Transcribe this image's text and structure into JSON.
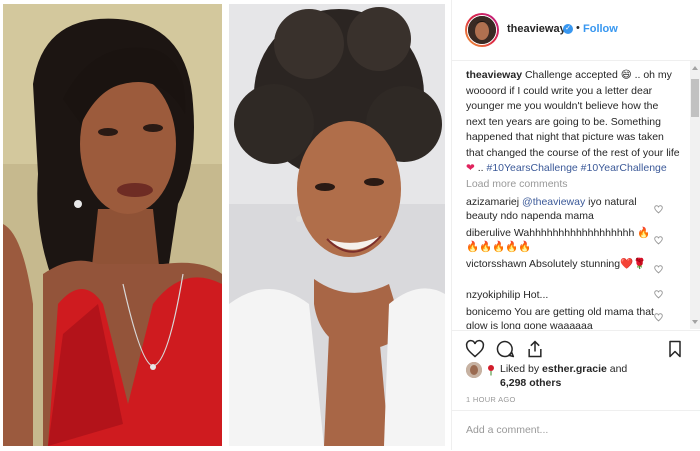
{
  "header": {
    "username": "theavieway",
    "separator": "•",
    "follow_label": "Follow",
    "verified_glyph": "✓"
  },
  "caption": {
    "username": "theavieway",
    "text": "Challenge accepted 😄 .. oh my woooord if I could write you a letter dear younger me you wouldn't believe how the next ten years are going to be. Something happened that night that picture was taken that changed the course of the rest of your life",
    "heart": "❤",
    "ellipsis": "..",
    "tags": "#10YearsChallenge #10YearChallenge"
  },
  "load_more_label": "Load more comments",
  "comments": [
    {
      "user": "azizamariej",
      "mention": "@theavieway",
      "text": "iyo natural beauty ndo napenda mama"
    },
    {
      "user": "diberulive",
      "mention": "",
      "text": "Wahhhhhhhhhhhhhhhhhh 🔥🔥🔥🔥🔥🔥"
    },
    {
      "user": "victorsshawn",
      "mention": "",
      "text": "Absolutely stunning❤️🌹"
    },
    {
      "user": "nzyokiphilip",
      "mention": "",
      "text": "Hot..."
    },
    {
      "user": "bonicemo",
      "mention": "",
      "text": "You are getting old mama that glow is long gone waaaaaa"
    }
  ],
  "likes": {
    "prefix": "Liked by",
    "user": "esther.gracie",
    "connector": "and",
    "count": "6,298 others"
  },
  "timestamp": "1 HOUR AGO",
  "add_comment_placeholder": "Add a comment...",
  "colors": {
    "accent": "#3897f0",
    "text": "#262626",
    "muted": "#999999",
    "tag": "#3b5998",
    "dress": "#d0141c"
  },
  "icons": [
    "heart-outline-icon",
    "comment-icon",
    "share-icon",
    "bookmark-icon",
    "verified-badge-icon"
  ]
}
